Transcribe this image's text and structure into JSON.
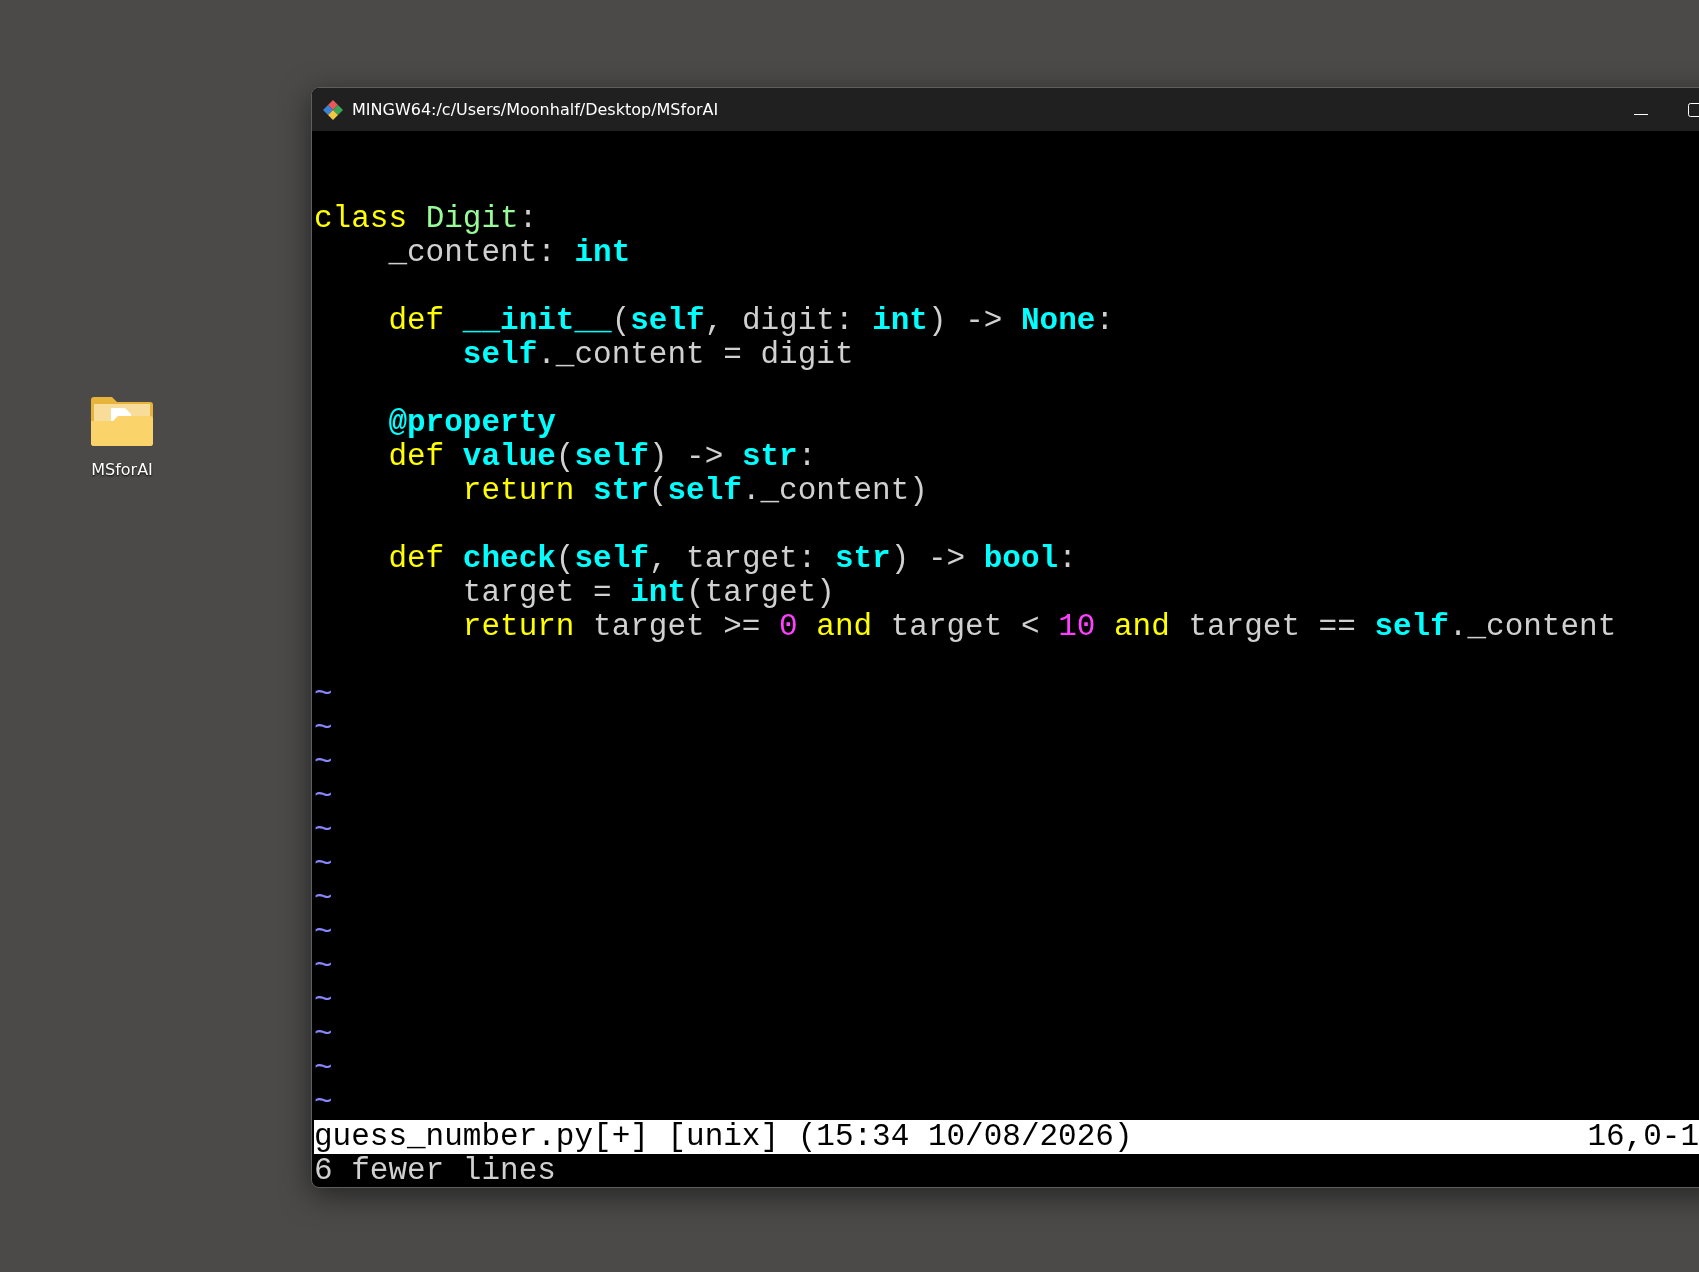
{
  "desktop": {
    "icons": [
      {
        "label": "MSforAI",
        "kind": "folder"
      }
    ]
  },
  "window": {
    "title": "MINGW64:/c/Users/Moonhalf/Desktop/MSforAI"
  },
  "editor": {
    "blocks": [
      {
        "lines": [
          {
            "tokens": [
              {
                "text": "class ",
                "kind": "keyword"
              },
              {
                "text": "Digit",
                "kind": "type"
              },
              {
                "text": ":",
                "kind": "plain"
              }
            ]
          },
          {
            "tokens": [
              {
                "text": "    _content: ",
                "kind": "plain"
              },
              {
                "text": "int",
                "kind": "builtin"
              }
            ]
          }
        ]
      },
      {
        "lines": [
          {
            "tokens": [
              {
                "text": "    def ",
                "kind": "keyword"
              },
              {
                "text": "__init__",
                "kind": "builtin"
              },
              {
                "text": "(",
                "kind": "plain"
              },
              {
                "text": "self",
                "kind": "builtin"
              },
              {
                "text": ", digit: ",
                "kind": "plain"
              },
              {
                "text": "int",
                "kind": "builtin"
              },
              {
                "text": ") -> ",
                "kind": "plain"
              },
              {
                "text": "None",
                "kind": "builtin"
              },
              {
                "text": ":",
                "kind": "plain"
              }
            ]
          },
          {
            "tokens": [
              {
                "text": "        self",
                "kind": "builtin"
              },
              {
                "text": "._content = digit",
                "kind": "plain"
              }
            ]
          }
        ]
      },
      {
        "lines": [
          {
            "tokens": [
              {
                "text": "    @property",
                "kind": "builtin"
              }
            ]
          },
          {
            "tokens": [
              {
                "text": "    def ",
                "kind": "keyword"
              },
              {
                "text": "value",
                "kind": "builtin"
              },
              {
                "text": "(",
                "kind": "plain"
              },
              {
                "text": "self",
                "kind": "builtin"
              },
              {
                "text": ") -> ",
                "kind": "plain"
              },
              {
                "text": "str",
                "kind": "builtin"
              },
              {
                "text": ":",
                "kind": "plain"
              }
            ]
          },
          {
            "tokens": [
              {
                "text": "        return ",
                "kind": "keyword"
              },
              {
                "text": "str",
                "kind": "builtin"
              },
              {
                "text": "(",
                "kind": "plain"
              },
              {
                "text": "self",
                "kind": "builtin"
              },
              {
                "text": "._content)",
                "kind": "plain"
              }
            ]
          }
        ]
      },
      {
        "lines": [
          {
            "tokens": [
              {
                "text": "    def ",
                "kind": "keyword"
              },
              {
                "text": "check",
                "kind": "builtin"
              },
              {
                "text": "(",
                "kind": "plain"
              },
              {
                "text": "self",
                "kind": "builtin"
              },
              {
                "text": ", target: ",
                "kind": "plain"
              },
              {
                "text": "str",
                "kind": "builtin"
              },
              {
                "text": ") -> ",
                "kind": "plain"
              },
              {
                "text": "bool",
                "kind": "builtin"
              },
              {
                "text": ":",
                "kind": "plain"
              }
            ]
          },
          {
            "tokens": [
              {
                "text": "        target = ",
                "kind": "plain"
              },
              {
                "text": "int",
                "kind": "builtin"
              },
              {
                "text": "(target)",
                "kind": "plain"
              }
            ]
          },
          {
            "tokens": [
              {
                "text": "        return ",
                "kind": "keyword"
              },
              {
                "text": "target >= ",
                "kind": "plain"
              },
              {
                "text": "0",
                "kind": "number"
              },
              {
                "text": " and ",
                "kind": "keyword"
              },
              {
                "text": "target < ",
                "kind": "plain"
              },
              {
                "text": "10",
                "kind": "number"
              },
              {
                "text": " and ",
                "kind": "keyword"
              },
              {
                "text": "target == ",
                "kind": "plain"
              },
              {
                "text": "self",
                "kind": "builtin"
              },
              {
                "text": "._content",
                "kind": "plain"
              }
            ]
          }
        ]
      }
    ],
    "empty_line_markers": [
      "~",
      "~",
      "~",
      "~",
      "~",
      "~",
      "~",
      "~",
      "~",
      "~",
      "~",
      "~",
      "~"
    ],
    "status_line": {
      "file_info": "guess_number.py[+] [unix] (15:34 10/08/2026)",
      "position": "16,0-1"
    },
    "message": "6 fewer lines"
  }
}
